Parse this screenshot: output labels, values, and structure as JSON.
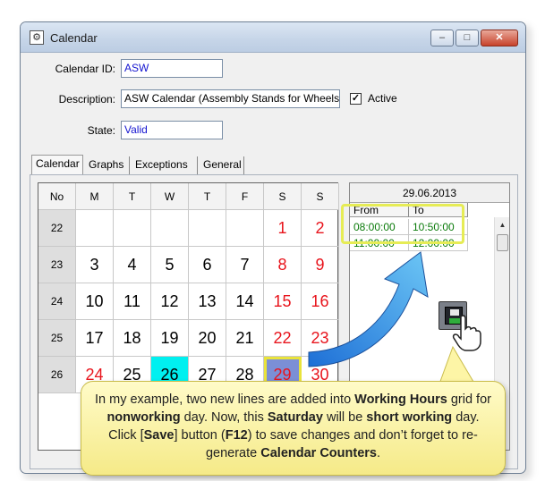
{
  "window": {
    "title": "Calendar",
    "buttons": [
      "–",
      "□",
      "✕"
    ]
  },
  "form": {
    "calendar_id_label": "Calendar ID:",
    "calendar_id_value": "ASW",
    "description_label": "Description:",
    "description_value": "ASW Calendar (Assembly Stands for Wheels)",
    "active_label": "Active",
    "active_checked": "✓",
    "state_label": "State:",
    "state_value": "Valid"
  },
  "tabs": [
    "Calendar",
    "Graphs",
    "Exceptions",
    "General"
  ],
  "calendar": {
    "headers": [
      "No",
      "M",
      "T",
      "W",
      "T",
      "F",
      "S",
      "S"
    ],
    "weeks": [
      {
        "no": "22",
        "days": [
          "",
          "",
          "",
          "",
          "",
          "1",
          "2"
        ]
      },
      {
        "no": "23",
        "days": [
          "3",
          "4",
          "5",
          "6",
          "7",
          "8",
          "9"
        ]
      },
      {
        "no": "24",
        "days": [
          "10",
          "11",
          "12",
          "13",
          "14",
          "15",
          "16"
        ]
      },
      {
        "no": "25",
        "days": [
          "17",
          "18",
          "19",
          "20",
          "21",
          "22",
          "23"
        ]
      },
      {
        "no": "26",
        "days": [
          "24",
          "25",
          "26",
          "27",
          "28",
          "29",
          "30"
        ]
      }
    ]
  },
  "hours": {
    "date": "29.06.2013",
    "columns": [
      "From",
      "To"
    ],
    "rows": [
      [
        "08:00:00",
        "10:50:00"
      ],
      [
        "11:00:00",
        "12:00:00"
      ]
    ]
  },
  "callout": {
    "s1": "In my example, two new lines are added into ",
    "b1": "Working Hours",
    "s2": " grid for ",
    "b2": "nonworking",
    "s3": " day. Now, this ",
    "b3": "Saturday",
    "s4": " will be ",
    "b4": "short working",
    "s5": " day. Click [",
    "b5": "Save",
    "s6": "] button (",
    "b6": "F12",
    "s7": ") to save changes and don’t forget to re-generate ",
    "b7": "Calendar Counters",
    "s8": "."
  },
  "colors": {
    "today": "#00f0f0",
    "selected": "#7b8fd6",
    "weekend": "#e8141c",
    "hours_text": "#0a7a0a",
    "highlight": "#e6ec55",
    "callout": "#fff6b0"
  },
  "icons": [
    "app-icon",
    "save-icon",
    "hand-cursor-icon",
    "arrow-icon",
    "scroll-up-icon",
    "check-icon"
  ]
}
